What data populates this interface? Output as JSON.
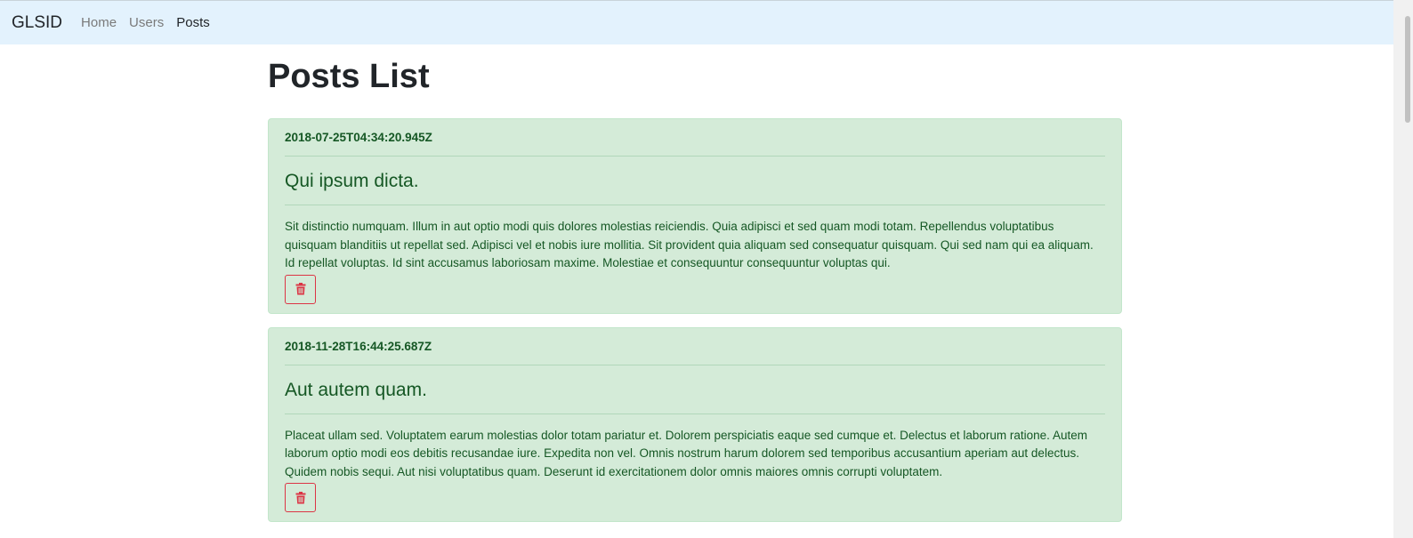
{
  "navbar": {
    "brand": "GLSID",
    "links": [
      {
        "label": "Home",
        "active": false
      },
      {
        "label": "Users",
        "active": false
      },
      {
        "label": "Posts",
        "active": true
      }
    ]
  },
  "page": {
    "title": "Posts List"
  },
  "posts": [
    {
      "date": "2018-07-25T04:34:20.945Z",
      "title": "Qui ipsum dicta.",
      "body": "Sit distinctio numquam. Illum in aut optio modi quis dolores molestias reiciendis. Quia adipisci et sed quam modi totam. Repellendus voluptatibus quisquam blanditiis ut repellat sed. Adipisci vel et nobis iure mollitia. Sit provident quia aliquam sed consequatur quisquam. Qui sed nam qui ea aliquam. Id repellat voluptas. Id sint accusamus laboriosam maxime. Molestiae et consequuntur consequuntur voluptas qui.",
      "delete_icon": "trash-icon"
    },
    {
      "date": "2018-11-28T16:44:25.687Z",
      "title": "Aut autem quam.",
      "body": "Placeat ullam sed. Voluptatem earum molestias dolor totam pariatur et. Dolorem perspiciatis eaque sed cumque et. Delectus et laborum ratione. Autem laborum optio modi eos debitis recusandae iure. Expedita non vel. Omnis nostrum harum dolorem sed temporibus accusantium aperiam aut delectus. Quidem nobis sequi. Aut nisi voluptatibus quam. Deserunt id exercitationem dolor omnis maiores omnis corrupti voluptatem.",
      "delete_icon": "trash-icon"
    }
  ],
  "colors": {
    "navbar_bg": "#e3f2fd",
    "card_bg": "#d4ebd8",
    "card_text": "#155724",
    "danger": "#dc3545"
  }
}
